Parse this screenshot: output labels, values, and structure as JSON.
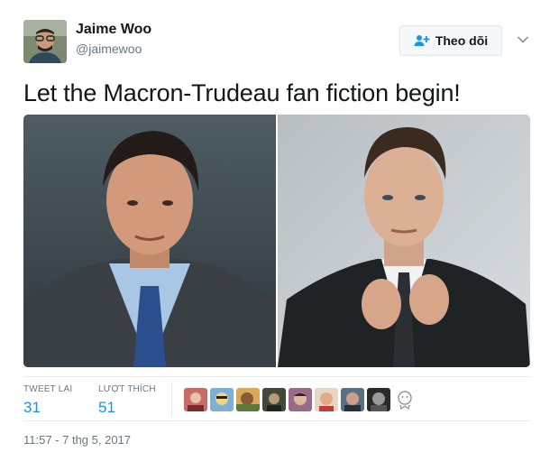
{
  "user": {
    "name": "Jaime Woo",
    "handle": "@jaimewoo"
  },
  "follow_button": {
    "label": "Theo dõi"
  },
  "tweet": {
    "text": "Let the Macron-Trudeau fan fiction begin!"
  },
  "stats": {
    "retweets": {
      "label": "TWEET LẠI",
      "value": "31"
    },
    "likes": {
      "label": "LƯỢT THÍCH",
      "value": "51"
    }
  },
  "timestamp": "11:57 - 7 thg 5, 2017",
  "colors": {
    "link_blue": "#1b95e0",
    "muted": "#657786",
    "border": "#e6ecf0"
  },
  "icons": {
    "follow": "add-user-icon",
    "caret": "chevron-down-icon",
    "more_likers": "face-icon"
  }
}
